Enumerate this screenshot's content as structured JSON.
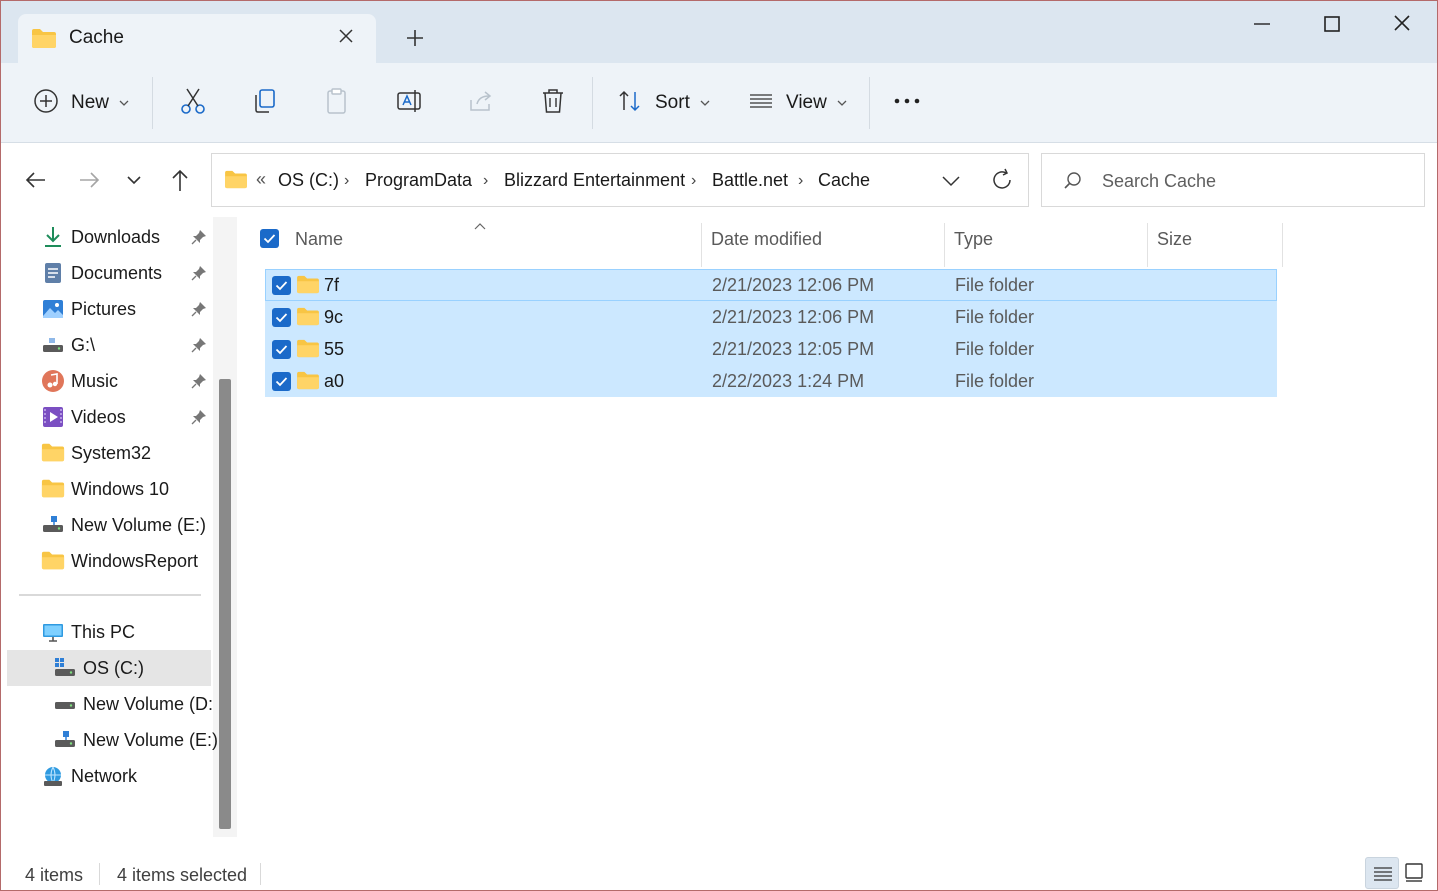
{
  "window": {
    "tab_title": "Cache",
    "tab_icon": "folder-icon"
  },
  "toolbar": {
    "new_label": "New",
    "sort_label": "Sort",
    "view_label": "View"
  },
  "breadcrumb": {
    "overflow": "«",
    "items": [
      "OS (C:)",
      "ProgramData",
      "Blizzard Entertainment",
      "Battle.net",
      "Cache"
    ]
  },
  "search": {
    "placeholder": "Search Cache"
  },
  "sidebar": {
    "quick_access": [
      {
        "label": "Downloads",
        "icon": "download-icon",
        "pinned": true
      },
      {
        "label": "Documents",
        "icon": "documents-icon",
        "pinned": true
      },
      {
        "label": "Pictures",
        "icon": "pictures-icon",
        "pinned": true
      },
      {
        "label": "G:\\",
        "icon": "drive-icon",
        "pinned": true
      },
      {
        "label": "Music",
        "icon": "music-icon",
        "pinned": true
      },
      {
        "label": "Videos",
        "icon": "videos-icon",
        "pinned": true
      },
      {
        "label": "System32",
        "icon": "folder-icon",
        "pinned": false
      },
      {
        "label": "Windows 10",
        "icon": "folder-icon",
        "pinned": false
      },
      {
        "label": "New Volume (E:)",
        "icon": "network-drive-icon",
        "pinned": false
      },
      {
        "label": "WindowsReport",
        "icon": "folder-icon",
        "pinned": false
      }
    ],
    "this_pc": {
      "label": "This PC",
      "icon": "monitor-icon"
    },
    "drives": [
      {
        "label": "OS (C:)",
        "icon": "windows-drive-icon",
        "selected": true
      },
      {
        "label": "New Volume (D:",
        "icon": "drive-icon"
      },
      {
        "label": "New Volume (E:)",
        "icon": "network-drive-icon"
      }
    ],
    "network": {
      "label": "Network",
      "icon": "network-icon"
    }
  },
  "columns": {
    "name": "Name",
    "date_modified": "Date modified",
    "type": "Type",
    "size": "Size"
  },
  "files": [
    {
      "name": "7f",
      "date": "2/21/2023 12:06 PM",
      "type": "File folder",
      "size": "",
      "selected": true
    },
    {
      "name": "9c",
      "date": "2/21/2023 12:06 PM",
      "type": "File folder",
      "size": "",
      "selected": true
    },
    {
      "name": "55",
      "date": "2/21/2023 12:05 PM",
      "type": "File folder",
      "size": "",
      "selected": true
    },
    {
      "name": "a0",
      "date": "2/22/2023 1:24 PM",
      "type": "File folder",
      "size": "",
      "selected": true
    }
  ],
  "status": {
    "item_count": "4 items",
    "selected_count": "4 items selected"
  },
  "colors": {
    "selection": "#cce8ff",
    "accent": "#1b6ac9",
    "folder": "#f8c544"
  }
}
